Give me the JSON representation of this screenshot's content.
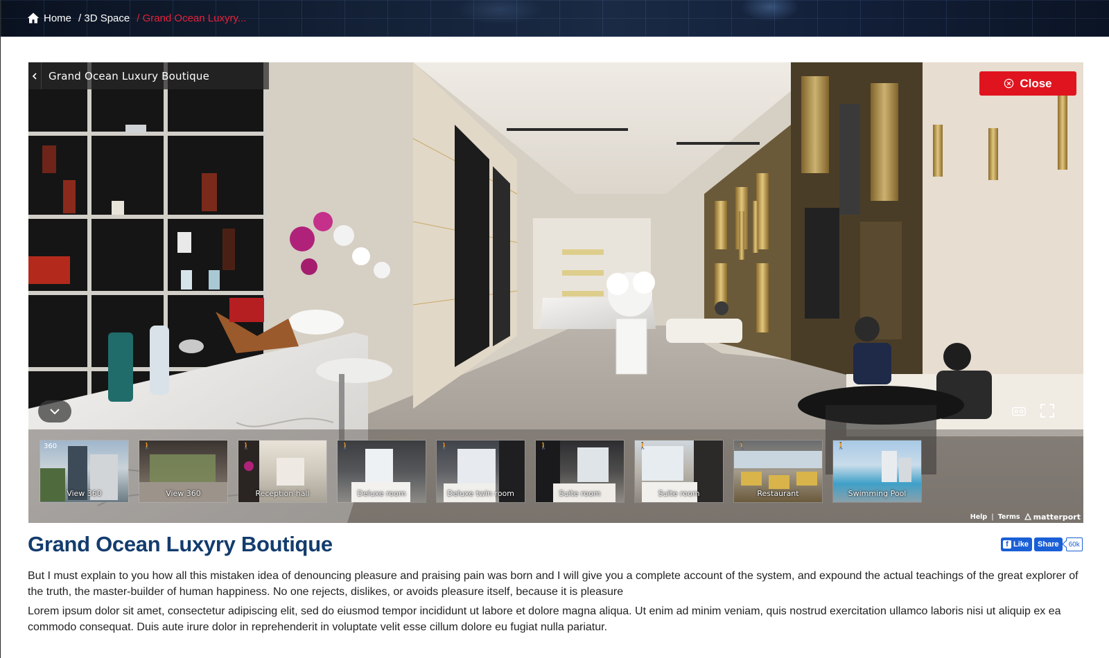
{
  "breadcrumb": {
    "items": [
      {
        "label": "Home",
        "icon": "home-icon"
      },
      {
        "label": "/ 3D Space"
      },
      {
        "label": "/ Grand Ocean Luxyry...",
        "current": true
      }
    ]
  },
  "viewer": {
    "title": "Grand Ocean Luxury Boutique",
    "close_label": "Close",
    "thumbnails": [
      {
        "label": "View 360",
        "badge": "360"
      },
      {
        "label": "View 360"
      },
      {
        "label": "Reception hall"
      },
      {
        "label": "Deluxe room"
      },
      {
        "label": "Deluxe twin room"
      },
      {
        "label": "Suite room"
      },
      {
        "label": "Suite room"
      },
      {
        "label": "Restaurant"
      },
      {
        "label": "Swimming Pool"
      }
    ],
    "footer": {
      "help": "Help",
      "separator": "|",
      "terms": "Terms",
      "brand": "matterport"
    }
  },
  "content": {
    "title": "Grand Ocean Luxyry Boutique",
    "paragraphs": [
      "But I must explain to you how all this mistaken idea of denouncing pleasure and praising pain was born and I will give you a complete account of the system, and expound the actual teachings of the great explorer of the truth, the master-builder of human happiness. No one rejects, dislikes, or avoids pleasure itself, because it is pleasure",
      "Lorem ipsum dolor sit amet, consectetur adipiscing elit, sed do eiusmod tempor incididunt ut labore et dolore magna aliqua. Ut enim ad minim veniam, quis nostrud exercitation ullamco laboris nisi ut aliquip ex ea commodo consequat. Duis aute irure dolor in reprehenderit in voluptate velit esse cillum dolore eu fugiat nulla pariatur."
    ]
  },
  "social": {
    "like_label": "Like",
    "share_label": "Share",
    "count": "60k"
  },
  "colors": {
    "accent_red": "#e0141f",
    "breadcrumb_current": "#e8213a",
    "title_blue": "#133c6e",
    "facebook_blue": "#1a5fd6"
  }
}
